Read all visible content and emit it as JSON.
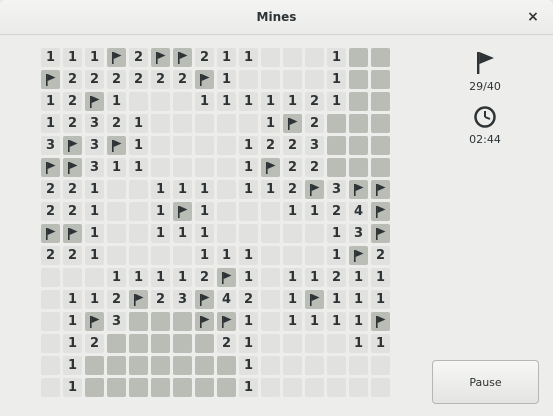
{
  "window": {
    "title": "Mines",
    "close_label": "×"
  },
  "status": {
    "flags": "29/40",
    "time": "02:44",
    "flag_icon": "flag-icon",
    "clock_icon": "clock-icon"
  },
  "pause_button": {
    "label": "Pause"
  },
  "colors": {
    "hidden_tile": "#babdb6",
    "open_tile": "#e1e1df",
    "number": "#2e3436"
  },
  "board": {
    "columns": 16,
    "rows": [
      [
        "1",
        "1",
        "1",
        "F",
        "2",
        "F",
        "F",
        "2",
        "1",
        "1",
        "",
        "",
        "",
        "1",
        "#",
        "#"
      ],
      [
        "F",
        "2",
        "2",
        "2",
        "2",
        "2",
        "2",
        "F",
        "1",
        "",
        "",
        "",
        "",
        "1",
        "#",
        "#"
      ],
      [
        "1",
        "2",
        "F",
        "1",
        "",
        "",
        "",
        "1",
        "1",
        "1",
        "1",
        "1",
        "2",
        "1",
        "#",
        "#"
      ],
      [
        "1",
        "2",
        "3",
        "2",
        "1",
        "",
        "",
        "",
        "",
        "",
        "1",
        "F",
        "2",
        "#",
        "#",
        "#"
      ],
      [
        "3",
        "F",
        "3",
        "F",
        "1",
        "",
        "",
        "",
        "",
        "1",
        "2",
        "2",
        "3",
        "#",
        "#",
        "#"
      ],
      [
        "F",
        "F",
        "3",
        "1",
        "1",
        "",
        "",
        "",
        "",
        "1",
        "F",
        "2",
        "2",
        "#",
        "#",
        "#"
      ],
      [
        "2",
        "2",
        "1",
        "",
        "",
        "1",
        "1",
        "1",
        "",
        "1",
        "1",
        "2",
        "F",
        "3",
        "F",
        "F"
      ],
      [
        "2",
        "2",
        "1",
        "",
        "",
        "1",
        "F",
        "1",
        "",
        "",
        "",
        "1",
        "1",
        "2",
        "4",
        "F"
      ],
      [
        "F",
        "F",
        "1",
        "",
        "",
        "1",
        "1",
        "1",
        "",
        "",
        "",
        "",
        "",
        "1",
        "3",
        "F"
      ],
      [
        "2",
        "2",
        "1",
        "",
        "",
        "",
        "",
        "1",
        "1",
        "1",
        "",
        "",
        "",
        "1",
        "F",
        "2"
      ],
      [
        "",
        "",
        "",
        "1",
        "1",
        "1",
        "1",
        "2",
        "F",
        "1",
        "",
        "1",
        "1",
        "2",
        "1",
        "1"
      ],
      [
        "",
        "1",
        "1",
        "2",
        "F",
        "2",
        "3",
        "F",
        "4",
        "2",
        "",
        "1",
        "F",
        "1",
        "1",
        "1"
      ],
      [
        "",
        "1",
        "F",
        "3",
        "#",
        "#",
        "#",
        "F",
        "F",
        "1",
        "",
        "1",
        "1",
        "1",
        "1",
        "F"
      ],
      [
        "",
        "1",
        "2",
        "#",
        "#",
        "#",
        "#",
        "#",
        "2",
        "1",
        "",
        "",
        "",
        "",
        "1",
        "1"
      ],
      [
        "",
        "1",
        "#",
        "#",
        "#",
        "#",
        "#",
        "#",
        "#",
        "1",
        "",
        "",
        "",
        "",
        "",
        ""
      ],
      [
        "",
        "1",
        "#",
        "#",
        "#",
        "#",
        "#",
        "#",
        "#",
        "1",
        "",
        "",
        "",
        "",
        "",
        ""
      ]
    ]
  }
}
